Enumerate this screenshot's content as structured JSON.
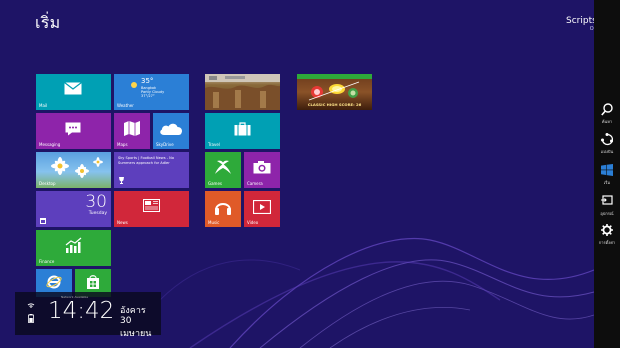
{
  "start": {
    "title": "เริ่ม"
  },
  "user": {
    "name": "Scripts",
    "subtitle": "OS"
  },
  "tiles": {
    "mail": "Mail",
    "weather": {
      "label": "Weather",
      "temp": "35°",
      "city": "Bangkok",
      "condition": "Partly Cloudy",
      "range": "37°/27°"
    },
    "messaging": "Messaging",
    "maps": "Maps",
    "skydrive": "SkyDrive",
    "desktop": "Desktop",
    "news": {
      "label": "News"
    },
    "sports": {
      "headline": "Sky Sports | Football News - No Summers approach for Adler"
    },
    "calendar": {
      "day_number": "30",
      "day_name": "Tuesday"
    },
    "travel": "Travel",
    "games": "Games",
    "camera": "Camera",
    "music": "Music",
    "video": "Video",
    "finance": "Finance",
    "game_promo": {
      "caption": "CLASSIC HIGH SCORE: 26"
    }
  },
  "charms": {
    "search": "ค้นหา",
    "share": "แบ่งปัน",
    "start": "เริ่ม",
    "devices": "อุปกรณ์",
    "settings": "การตั้งค่า"
  },
  "clock": {
    "time": "14:42",
    "day": "อังคาร",
    "date": "30 เมษายน",
    "status": "Network Available"
  },
  "colors": {
    "background": "#1e1466",
    "teal": "#00a0b4",
    "blue": "#2b7fd6",
    "purple": "#8e24aa",
    "lavender": "#5d3fbd",
    "red": "#d1273a",
    "green": "#2eaa3a",
    "orange": "#e05a28"
  }
}
